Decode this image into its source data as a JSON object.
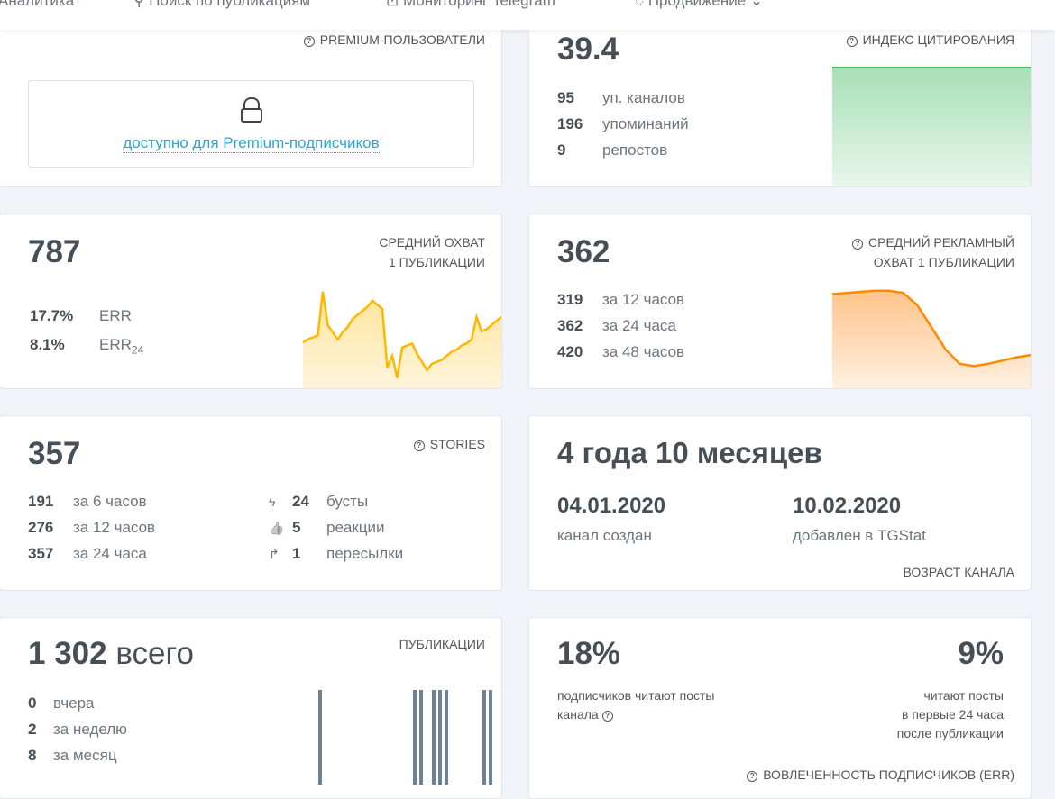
{
  "nav": [
    "Аналитика",
    "Поиск по публикациям",
    "Мониторинг Telegram",
    "Продвижение"
  ],
  "premium": {
    "label": "PREMIUM-ПОЛЬЗОВАТЕЛИ",
    "link": "доступно для Premium-подписчиков"
  },
  "citation": {
    "value": "39.4",
    "label": "ИНДЕКС ЦИТИРОВАНИЯ",
    "rows": [
      {
        "n": "95",
        "t": "уп. каналов"
      },
      {
        "n": "196",
        "t": "упоминаний"
      },
      {
        "n": "9",
        "t": "репостов"
      }
    ],
    "color": "#3dbb5b"
  },
  "reach": {
    "value": "787",
    "label1": "СРЕДНИЙ ОХВАТ",
    "label2": "1 ПУБЛИКАЦИИ",
    "err": "17.7%",
    "err_label": "ERR",
    "err24": "8.1%",
    "err24_label": "ERR",
    "err24_sub": "24",
    "color": "#ffb700",
    "spark": [
      45,
      48,
      50,
      52,
      95,
      62,
      55,
      48,
      55,
      60,
      68,
      72,
      76,
      80,
      86,
      82,
      78,
      20,
      32,
      10,
      40,
      42,
      44,
      34,
      26,
      18,
      24,
      26,
      28,
      32,
      36,
      38,
      42,
      44,
      48,
      70,
      56,
      58,
      62,
      66,
      70
    ]
  },
  "ad_reach": {
    "value": "362",
    "label1": "СРЕДНИЙ РЕКЛАМНЫЙ",
    "label2": "ОХВАТ 1 ПУБЛИКАЦИИ",
    "rows": [
      {
        "n": "319",
        "t": "за 12 часов"
      },
      {
        "n": "362",
        "t": "за 24 часа"
      },
      {
        "n": "420",
        "t": "за 48 часов"
      }
    ],
    "color": "#ff8a00",
    "spark": [
      85,
      86,
      87,
      88,
      88,
      86,
      75,
      55,
      35,
      22,
      20,
      22,
      25,
      28,
      30
    ]
  },
  "stories": {
    "value": "357",
    "label": "STORIES",
    "rows": [
      {
        "n": "191",
        "t": "за 6 часов"
      },
      {
        "n": "276",
        "t": "за 12 часов"
      },
      {
        "n": "357",
        "t": "за 24 часа"
      }
    ],
    "extra": [
      {
        "icon": "lightning-icon",
        "g": "ϟ",
        "n": "24",
        "t": "бусты"
      },
      {
        "icon": "thumbs-up-icon",
        "g": "👍",
        "n": "5",
        "t": "реакции"
      },
      {
        "icon": "share-arrow-icon",
        "g": "↱",
        "n": "1",
        "t": "пересылки"
      }
    ]
  },
  "age": {
    "value": "4 года 10 месяцев",
    "created": "04.01.2020",
    "created_label": "канал создан",
    "added": "10.02.2020",
    "added_label": "добавлен в TGStat",
    "label": "ВОЗРАСТ КАНАЛА"
  },
  "posts": {
    "value": "1 302",
    "suffix": "всего",
    "label": "ПУБЛИКАЦИИ",
    "rows": [
      {
        "n": "0",
        "t": "вчера"
      },
      {
        "n": "2",
        "t": "за неделю"
      },
      {
        "n": "8",
        "t": "за месяц"
      }
    ],
    "bars_days_ago": [
      28,
      13,
      12,
      10,
      9,
      8,
      2,
      1
    ]
  },
  "err": {
    "v1": "18%",
    "t1a": "подписчиков читают посты",
    "t1b": "канала",
    "v2": "9%",
    "t2a": "читают посты",
    "t2b": "в первые 24 часа",
    "t2c": "после публикации",
    "label": "ВОВЛЕЧЕННОСТЬ ПОДПИСЧИКОВ (ERR)"
  }
}
